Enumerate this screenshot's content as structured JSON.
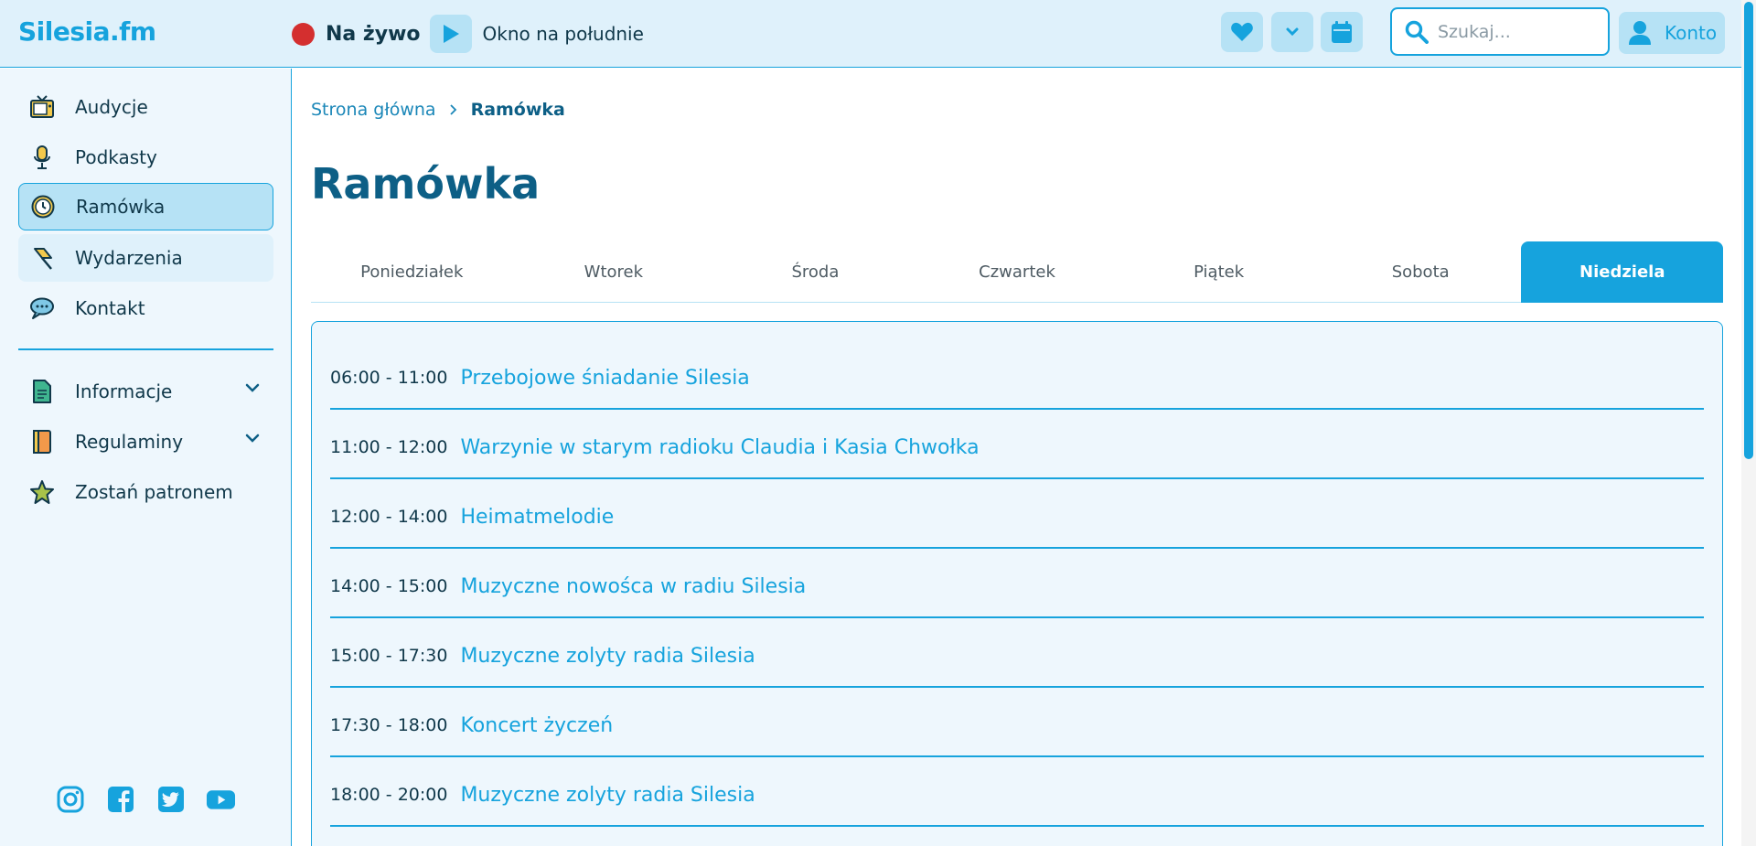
{
  "header": {
    "logo": "Silesia.fm",
    "live_label": "Na żywo",
    "now_playing": "Okno na południe",
    "search_placeholder": "Szukaj...",
    "account_label": "Konto"
  },
  "sidebar": {
    "items": [
      {
        "label": "Audycje",
        "icon": "tv-icon"
      },
      {
        "label": "Podkasty",
        "icon": "microphone-icon"
      },
      {
        "label": "Ramówka",
        "icon": "clock-icon"
      },
      {
        "label": "Wydarzenia",
        "icon": "pin-icon"
      },
      {
        "label": "Kontakt",
        "icon": "speech-bubble-icon"
      }
    ],
    "sections": [
      {
        "label": "Informacje",
        "icon": "document-icon"
      },
      {
        "label": "Regulaminy",
        "icon": "book-icon"
      },
      {
        "label": "Zostań patronem",
        "icon": "star-icon"
      }
    ],
    "socials": [
      "instagram-icon",
      "facebook-icon",
      "twitter-icon",
      "youtube-icon"
    ]
  },
  "breadcrumb": {
    "home": "Strona główna",
    "current": "Ramówka"
  },
  "page_title": "Ramówka",
  "tabs": [
    "Poniedziałek",
    "Wtorek",
    "Środa",
    "Czwartek",
    "Piątek",
    "Sobota",
    "Niedziela"
  ],
  "active_tab": "Niedziela",
  "schedule": [
    {
      "time": "06:00 - 11:00",
      "title": "Przebojowe śniadanie Silesia"
    },
    {
      "time": "11:00 - 12:00",
      "title": "Warzynie w starym radioku Claudia i Kasia Chwołka"
    },
    {
      "time": "12:00 - 14:00",
      "title": "Heimatmelodie"
    },
    {
      "time": "14:00 - 15:00",
      "title": "Muzyczne nowośca w radiu Silesia"
    },
    {
      "time": "15:00 - 17:30",
      "title": "Muzyczne zolyty radia Silesia"
    },
    {
      "time": "17:30 - 18:00",
      "title": "Koncert życzeń"
    },
    {
      "time": "18:00 - 20:00",
      "title": "Muzyczne zolyty radia Silesia"
    }
  ],
  "colors": {
    "accent": "#16a3dd",
    "dark": "#0d5f86",
    "live": "#d42f2f"
  }
}
